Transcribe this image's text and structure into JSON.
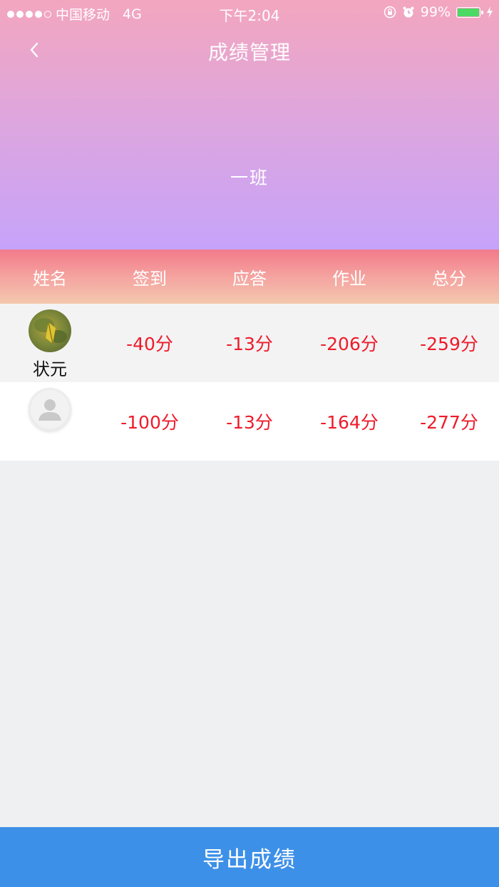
{
  "status_bar": {
    "carrier": "中国移动",
    "network": "4G",
    "time": "下午2:04",
    "battery_percent": "99%",
    "battery_level": 0.99,
    "battery_color": "#4cd964",
    "icons": [
      "signal-dots",
      "rotation-lock-icon",
      "alarm-icon",
      "battery-icon",
      "charging-bolt-icon"
    ]
  },
  "nav": {
    "back_icon": "chevron-left-icon",
    "title": "成绩管理"
  },
  "class_name": "一班",
  "table": {
    "headers": [
      "姓名",
      "签到",
      "应答",
      "作业",
      "总分"
    ],
    "rows": [
      {
        "name": "状元",
        "avatar": "photo",
        "checkin": "-40分",
        "answer": "-13分",
        "homework": "-206分",
        "total": "-259分"
      },
      {
        "name": "",
        "avatar": "default-avatar-icon",
        "checkin": "-100分",
        "answer": "-13分",
        "homework": "-164分",
        "total": "-277分"
      }
    ]
  },
  "export_button": {
    "label": "导出成绩"
  },
  "colors": {
    "score_red": "#ee1b2a",
    "export_blue": "#3d90e8",
    "header_gradient": [
      "#f3a6be",
      "#c6a3fa"
    ],
    "table_head_gradient": [
      "#f27a8a",
      "#f3c8ae"
    ]
  }
}
